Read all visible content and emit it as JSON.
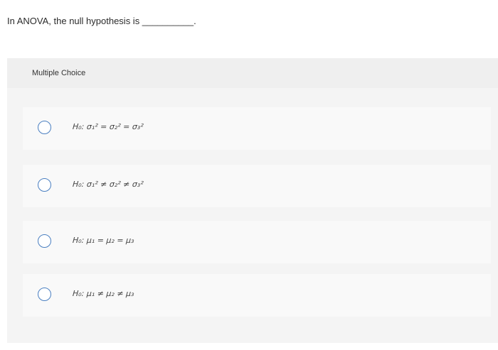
{
  "question": {
    "text": "In ANOVA, the null hypothesis is __________."
  },
  "section": {
    "label": "Multiple Choice"
  },
  "options": [
    {
      "text": "H₀: σ₁² = σ₂² = σ₃²"
    },
    {
      "text": "H₀: σ₁² ≠ σ₂² ≠ σ₃²"
    },
    {
      "text": "H₀: μ₁ = μ₂  = μ₃"
    },
    {
      "text": "H₀: μ₁ ≠ μ₂ ≠ μ₃"
    }
  ],
  "colors": {
    "radio_border": "#4a7fc1",
    "panel_bg": "#f4f4f4",
    "option_bg": "#f9f9f9"
  }
}
